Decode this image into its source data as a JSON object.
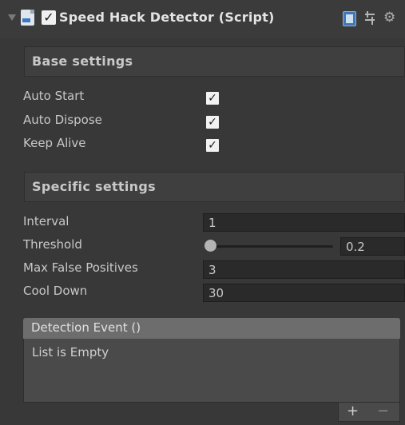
{
  "header": {
    "title": "Speed Hack Detector (Script)",
    "enabled": true
  },
  "sections": {
    "base": "Base settings",
    "specific": "Specific settings"
  },
  "base_settings": [
    {
      "label": "Auto Start",
      "checked": true
    },
    {
      "label": "Auto Dispose",
      "checked": true
    },
    {
      "label": "Keep Alive",
      "checked": true
    }
  ],
  "specific_settings": {
    "interval": {
      "label": "Interval",
      "value": "1"
    },
    "threshold": {
      "label": "Threshold",
      "value": "0.2",
      "slider_fraction": 0.0
    },
    "max_false_positives": {
      "label": "Max False Positives",
      "value": "3"
    },
    "cool_down": {
      "label": "Cool Down",
      "value": "30"
    }
  },
  "event": {
    "header": "Detection Event ()",
    "empty_text": "List is Empty",
    "add_label": "+",
    "remove_label": "−"
  },
  "icons": {
    "checkmark": "✓",
    "gear": "⚙"
  },
  "colors": {
    "background": "#383838",
    "field": "#2a2a2a",
    "event_header": "#6d6d6d",
    "help_blue": "#3f78b5"
  }
}
